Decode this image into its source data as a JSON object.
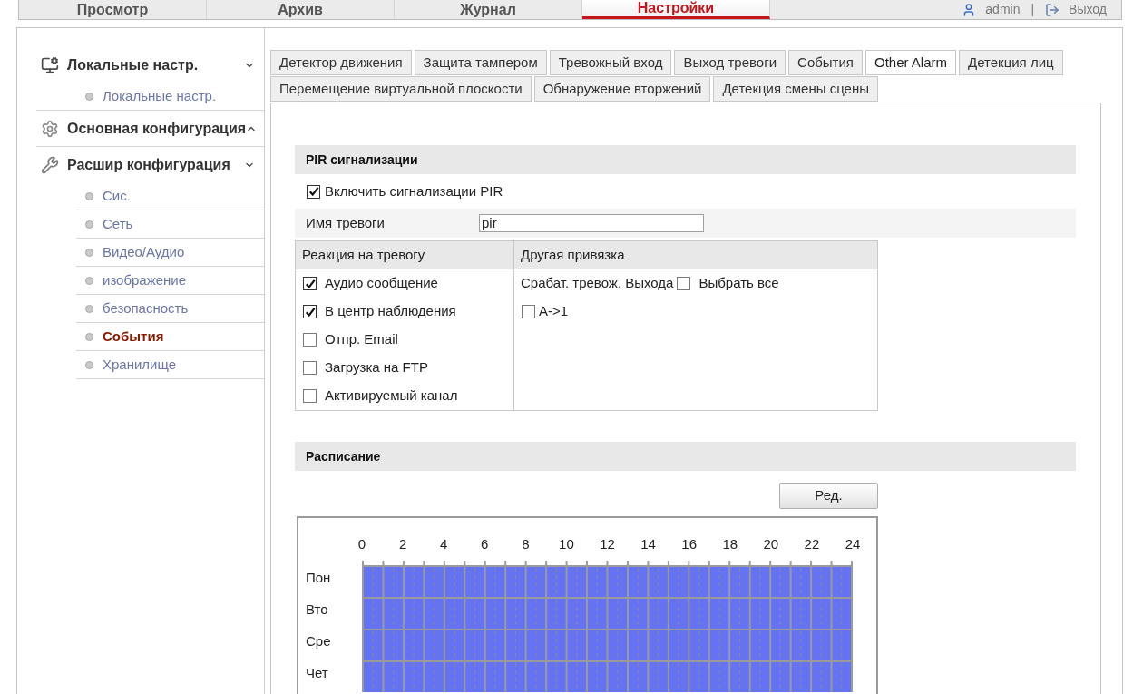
{
  "top_nav": {
    "tabs": [
      {
        "label": "Просмотр",
        "selected": false
      },
      {
        "label": "Архив",
        "selected": false
      },
      {
        "label": "Журнал",
        "selected": false
      },
      {
        "label": "Настройки",
        "selected": true
      }
    ],
    "user": "admin",
    "separator": "|",
    "logout": "Выход"
  },
  "sidebar": {
    "groups": [
      {
        "title": "Локальные настр.",
        "expanded": true,
        "items": [
          {
            "label": "Локальные настр.",
            "selected": false
          }
        ]
      },
      {
        "title": "Основная конфигурация",
        "expanded": false
      },
      {
        "title": "Расшир конфигурация",
        "expanded": true,
        "items": [
          {
            "label": "Сис.",
            "selected": false
          },
          {
            "label": "Сеть",
            "selected": false
          },
          {
            "label": "Видео/Аудио",
            "selected": false
          },
          {
            "label": "изображение",
            "selected": false
          },
          {
            "label": "безопасность",
            "selected": false
          },
          {
            "label": "События",
            "selected": true
          },
          {
            "label": "Хранилище",
            "selected": false
          }
        ]
      }
    ]
  },
  "tabs": [
    {
      "label": "Детектор движения",
      "selected": false
    },
    {
      "label": "Защита тампером",
      "selected": false
    },
    {
      "label": "Тревожный вход",
      "selected": false
    },
    {
      "label": "Выход тревоги",
      "selected": false
    },
    {
      "label": "События",
      "selected": false
    },
    {
      "label": "Other Alarm",
      "selected": true
    },
    {
      "label": "Детекция лиц",
      "selected": false
    },
    {
      "label": "Перемещение виртуальной плоскости",
      "selected": false
    },
    {
      "label": "Обнаружение вторжений",
      "selected": false
    },
    {
      "label": "Детекция смены сцены",
      "selected": false
    }
  ],
  "pir": {
    "title": "PIR сигнализации",
    "enable": {
      "label": "Включить сигнализации PIR",
      "checked": true
    },
    "name": {
      "label": "Имя тревоги",
      "value": "pir"
    },
    "linkage": {
      "columns": [
        "Реакция на тревогу",
        "Другая привязка"
      ],
      "actions": [
        {
          "label": "Аудио сообщение",
          "checked": true
        },
        {
          "label": "В центр наблюдения",
          "checked": true
        },
        {
          "label": "Отпр. Email",
          "checked": false
        },
        {
          "label": "Загрузка на FTP",
          "checked": false
        },
        {
          "label": "Активируемый канал",
          "checked": false
        }
      ],
      "other": {
        "label": "Срабат. тревож. Выхода",
        "select_all": {
          "label": "Выбрать все",
          "checked": false
        },
        "outputs": [
          {
            "label": "A->1",
            "checked": false
          }
        ]
      }
    }
  },
  "schedule": {
    "title": "Расписание",
    "edit_button": "Ред.",
    "hours": [
      "0",
      "2",
      "4",
      "6",
      "8",
      "10",
      "12",
      "14",
      "16",
      "18",
      "20",
      "22",
      "24"
    ],
    "days": [
      {
        "label": "Пон",
        "level": 1
      },
      {
        "label": "Вто",
        "level": 1
      },
      {
        "label": "Сре",
        "level": 1
      },
      {
        "label": "Чет",
        "level": 1
      }
    ]
  }
}
